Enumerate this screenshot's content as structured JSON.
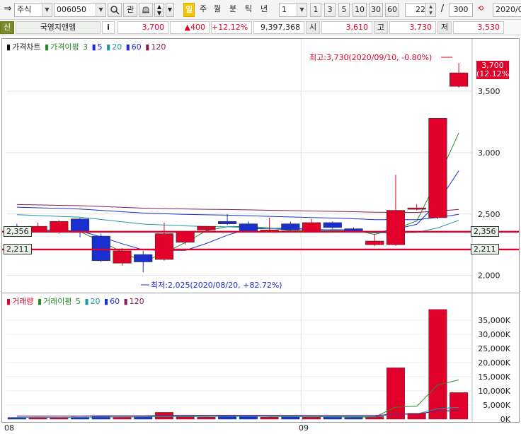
{
  "toolbar": {
    "market": "주식",
    "code": "006050",
    "btn_interest": "관",
    "period_min_label": "분",
    "periods": [
      "일",
      "주",
      "월",
      "분",
      "틱",
      "년"
    ],
    "active_period": "일",
    "interval_value": "1",
    "intervals": [
      "1",
      "3",
      "5",
      "10",
      "30",
      "60"
    ],
    "display_count": "22",
    "separator": "/",
    "total_count": "300",
    "date": "2020/0"
  },
  "quote": {
    "badge": "신",
    "name": "국영지앤엠",
    "info_btn": "i",
    "price": "3,700",
    "change": "▲400",
    "change_pct": "+12.12%",
    "volume": "9,397,368",
    "open_label": "시",
    "open": "3,610",
    "high_label": "고",
    "high": "3,730",
    "low_label": "저",
    "low": "3,530"
  },
  "price_pane": {
    "legend_title": "가격차트",
    "ma_title": "가격이평",
    "ma_periods": [
      "3",
      "5",
      "20",
      "60",
      "120"
    ],
    "ma_colors": [
      "#2a8a2a",
      "#1a2fd0",
      "#1a9aa8",
      "#1a2fd0",
      "#8a1a5a"
    ],
    "axis_ticks": [
      "3,500",
      "3,000",
      "2,500",
      "2,000"
    ],
    "current_tag": "3,700",
    "current_pct": "(12.12%)",
    "high_annotation": "최고:3,730(2020/09/10, -0.80%)",
    "low_annotation": "최저:2,025(2020/08/20, +82.72%)",
    "hline_left_top": "2,356",
    "hline_left_bottom": "2,211",
    "hline_right_top": "2,356",
    "hline_right_bottom": "2,211"
  },
  "volume_pane": {
    "legend_title": "거래량",
    "ma_title": "거래이평",
    "ma_periods": [
      "5",
      "20",
      "60",
      "120"
    ],
    "axis_ticks": [
      "35,000K",
      "30,000K",
      "25,000K",
      "20,000K",
      "15,000K",
      "10,000K",
      "5,000K",
      "0K"
    ]
  },
  "x_axis": {
    "labels": [
      "08",
      "09"
    ]
  },
  "chart_data": {
    "type": "candlestick",
    "price_ylim": [
      1900,
      3800
    ],
    "volume_ylim": [
      0,
      40000
    ],
    "volume_unit": "K",
    "candles": [
      {
        "o": 2370,
        "h": 2420,
        "l": 2330,
        "c": 2380,
        "dir": "down",
        "vol": 600
      },
      {
        "o": 2400,
        "h": 2430,
        "l": 2350,
        "c": 2360,
        "dir": "up",
        "vol": 700
      },
      {
        "o": 2440,
        "h": 2450,
        "l": 2340,
        "c": 2360,
        "dir": "up",
        "vol": 600
      },
      {
        "o": 2460,
        "h": 2470,
        "l": 2310,
        "c": 2350,
        "dir": "down",
        "vol": 800
      },
      {
        "o": 2320,
        "h": 2340,
        "l": 2110,
        "c": 2120,
        "dir": "down",
        "vol": 1200
      },
      {
        "o": 2200,
        "h": 2220,
        "l": 2080,
        "c": 2100,
        "dir": "up",
        "vol": 800
      },
      {
        "o": 2170,
        "h": 2200,
        "l": 2025,
        "c": 2110,
        "dir": "down",
        "vol": 900
      },
      {
        "o": 2130,
        "h": 2430,
        "l": 2120,
        "c": 2340,
        "dir": "up",
        "vol": 2400
      },
      {
        "o": 2270,
        "h": 2350,
        "l": 2250,
        "c": 2350,
        "dir": "up",
        "vol": 800
      },
      {
        "o": 2370,
        "h": 2400,
        "l": 2360,
        "c": 2400,
        "dir": "up",
        "vol": 700
      },
      {
        "o": 2420,
        "h": 2500,
        "l": 2410,
        "c": 2440,
        "dir": "down",
        "vol": 1400
      },
      {
        "o": 2420,
        "h": 2440,
        "l": 2350,
        "c": 2360,
        "dir": "down",
        "vol": 1000
      },
      {
        "o": 2370,
        "h": 2470,
        "l": 2350,
        "c": 2360,
        "dir": "up",
        "vol": 700
      },
      {
        "o": 2420,
        "h": 2440,
        "l": 2350,
        "c": 2370,
        "dir": "down",
        "vol": 800
      },
      {
        "o": 2430,
        "h": 2460,
        "l": 2350,
        "c": 2360,
        "dir": "up",
        "vol": 700
      },
      {
        "o": 2430,
        "h": 2440,
        "l": 2380,
        "c": 2390,
        "dir": "down",
        "vol": 900
      },
      {
        "o": 2380,
        "h": 2390,
        "l": 2350,
        "c": 2360,
        "dir": "down",
        "vol": 600
      },
      {
        "o": 2280,
        "h": 2330,
        "l": 2240,
        "c": 2250,
        "dir": "up",
        "vol": 900
      },
      {
        "o": 2250,
        "h": 2820,
        "l": 2240,
        "c": 2530,
        "dir": "up",
        "vol": 18200
      },
      {
        "o": 2550,
        "h": 2580,
        "l": 2530,
        "c": 2550,
        "dir": "up",
        "vol": 2100
      },
      {
        "o": 2470,
        "h": 3280,
        "l": 2460,
        "c": 3280,
        "dir": "up",
        "vol": 38800
      },
      {
        "o": 3540,
        "h": 3730,
        "l": 3530,
        "c": 3650,
        "dir": "up",
        "vol": 9400
      }
    ],
    "price_hlines": [
      2356,
      2211
    ]
  }
}
